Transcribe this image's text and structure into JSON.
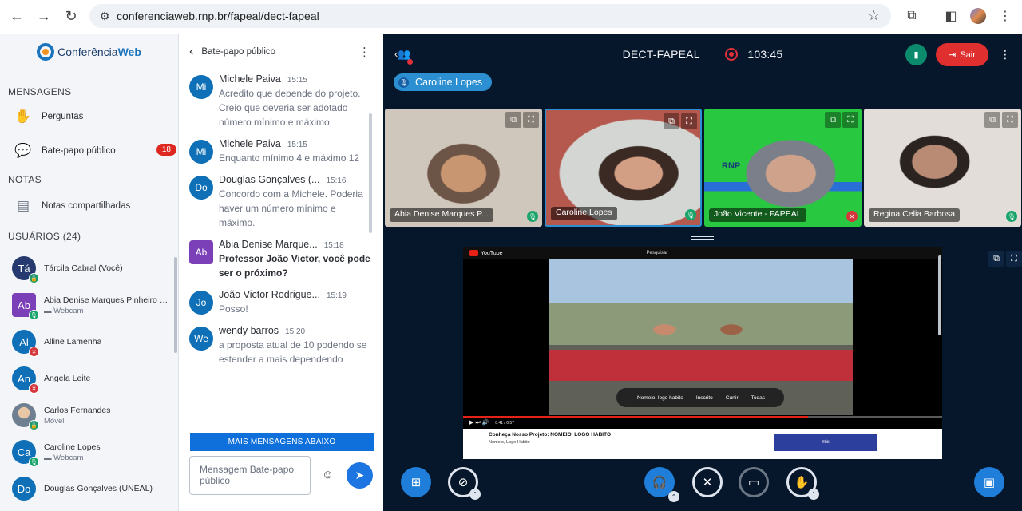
{
  "browser": {
    "url": "conferenciaweb.rnp.br/fapeal/dect-fapeal",
    "back_icon": "←",
    "forward_icon": "→",
    "reload_icon": "↻",
    "tune_icon": "⚙",
    "star_icon": "☆",
    "extensions_icon": "⧉",
    "sidepanel_icon": "◧",
    "menu_icon": "⋮"
  },
  "sidebar": {
    "logo_text_a": "Conferência",
    "logo_text_b": "Web",
    "messages_title": "MENSAGENS",
    "questions_label": "Perguntas",
    "public_chat_label": "Bate-papo público",
    "public_chat_unread": "18",
    "notes_title": "NOTAS",
    "shared_notes_label": "Notas compartilhadas",
    "users_title": "USUÁRIOS",
    "users_count": "(24)",
    "users": [
      {
        "initials": "Tá",
        "name": "Tárcila Cabral (Você)",
        "status": "",
        "badge": "🔒"
      },
      {
        "initials": "Ab",
        "name": "Abia Denise Marques Pinheiro de Oliveira",
        "status": "▬ Webcam",
        "badge": "🎙"
      },
      {
        "initials": "Al",
        "name": "Alline Lamenha",
        "status": "",
        "badge": "✕"
      },
      {
        "initials": "An",
        "name": "Angela Leite",
        "status": "",
        "badge": "✕"
      },
      {
        "initials": "",
        "name": "Carlos Fernandes",
        "status": "Móvel",
        "badge": "🔒"
      },
      {
        "initials": "Ca",
        "name": "Caroline Lopes",
        "status": "▬ Webcam",
        "badge": "🎙"
      },
      {
        "initials": "Do",
        "name": "Douglas Gonçalves (UNEAL)",
        "status": "",
        "badge": ""
      }
    ]
  },
  "chat": {
    "title": "Bate-papo público",
    "messages": [
      {
        "initials": "Mi",
        "name": "Michele Paiva",
        "time": "15:15",
        "text": "Acredito que depende do projeto. Creio que deveria ser adotado número mínimo e máximo."
      },
      {
        "initials": "Mi",
        "name": "Michele Paiva",
        "time": "15:15",
        "text": "Enquanto mínimo 4 e máximo 12"
      },
      {
        "initials": "Do",
        "name": "Douglas Gonçalves (...",
        "time": "15:16",
        "text": "Concordo com a Michele. Poderia haver um número mínimo e máximo."
      },
      {
        "initials": "Ab",
        "name": "Abia Denise Marque...",
        "time": "15:18",
        "text": "Professor João Victor, você pode ser o próximo?"
      },
      {
        "initials": "Jo",
        "name": "João Victor Rodrigue...",
        "time": "15:19",
        "text": "Posso!"
      },
      {
        "initials": "We",
        "name": "wendy barros",
        "time": "15:20",
        "text": "a proposta atual de 10 podendo se estender a mais dependendo"
      }
    ],
    "more_label": "MAIS MENSAGENS ABAIXO",
    "input_placeholder": "Mensagem Bate-papo público",
    "emoji_icon": "☺",
    "send_icon": "➤"
  },
  "meeting": {
    "title": "DECT-FAPEAL",
    "recording_time": "103:45",
    "leave_label": "Sair",
    "talking_indicator": "Caroline Lopes",
    "participants": [
      {
        "name": "Abia Denise Marques P...",
        "mic": "on"
      },
      {
        "name": "Caroline Lopes",
        "mic": "on"
      },
      {
        "name": "João Vicente - FAPEAL",
        "mic": "muted"
      },
      {
        "name": "Regina Celia Barbosa",
        "mic": "on"
      }
    ],
    "tile3_logo": "RNP"
  },
  "screenshare": {
    "yt_logo": "YouTube",
    "search_label": "Pesquisar",
    "popup_channel": "Nomeio, logo habito",
    "popup_subscribed": "Inscrito",
    "popup_like": "Curtir",
    "popup_all": "Todas",
    "video_title": "Conheça Nosso Projeto: NOMEIO, LOGO HABITO",
    "channel": "Nomeio, Logo Habito",
    "time": "0:41 / 0:57",
    "progress": 0.72,
    "thumb_label": "mix"
  }
}
